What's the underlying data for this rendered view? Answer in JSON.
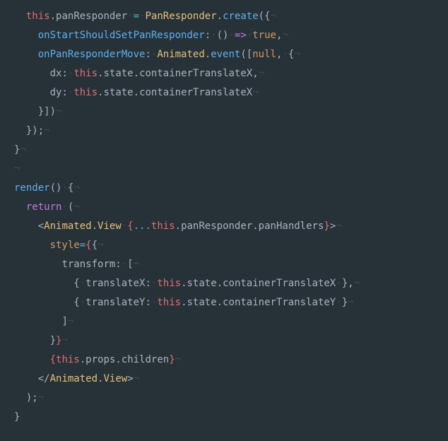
{
  "code": {
    "l1": {
      "this": "this",
      "dot": ".",
      "panResponder": "panResponder",
      "sp": " ",
      "eq": "=",
      "cls": "PanResponder",
      "create": "create",
      "lp": "(",
      "lb": "{"
    },
    "l2": {
      "key": "onStartShouldSetPanResponder",
      "colon": ":",
      "lp": "(",
      "rp": ")",
      "arrow": "=>",
      "val": "true",
      "comma": ","
    },
    "l3": {
      "key": "onPanResponderMove",
      "colon": ":",
      "cls": "Animated",
      "dot": ".",
      "event": "event",
      "lp": "(",
      "lsb": "[",
      "null": "null",
      "comma": ",",
      "lb": "{"
    },
    "l4": {
      "key": "dx",
      "colon": ":",
      "this": "this",
      "dot": ".",
      "state": "state",
      "ctr": "containerTranslateX",
      "comma": ","
    },
    "l5": {
      "key": "dy",
      "colon": ":",
      "this": "this",
      "dot": ".",
      "state": "state",
      "ctr": "containerTranslateX"
    },
    "l6": {
      "rb": "}",
      "rsb": "]",
      "rp": ")"
    },
    "l7": {
      "rb": "}",
      "rp": ")",
      "semi": ";"
    },
    "l8": {
      "rb": "}"
    },
    "l10": {
      "render": "render",
      "lp": "(",
      "rp": ")",
      "lb": "{"
    },
    "l11": {
      "return": "return",
      "lp": "("
    },
    "l12": {
      "lt": "<",
      "cls": "Animated",
      "dot": ".",
      "view": "View",
      "sp": " ",
      "lb": "{",
      "spread": "...",
      "this": "this",
      "pr": "panResponder",
      "ph": "panHandlers",
      "rb": "}",
      "gt": ">"
    },
    "l13": {
      "attr": "style",
      "eq": "=",
      "lb1": "{",
      "lb2": "{"
    },
    "l14": {
      "key": "transform",
      "colon": ":",
      "lsb": "["
    },
    "l15": {
      "lb": "{",
      "key": "translateX",
      "colon": ":",
      "this": "this",
      "dot": ".",
      "state": "state",
      "ctr": "containerTranslateX",
      "rb": "}",
      "comma": ","
    },
    "l16": {
      "lb": "{",
      "key": "translateY",
      "colon": ":",
      "this": "this",
      "dot": ".",
      "state": "state",
      "ctr": "containerTranslateY",
      "rb": "}"
    },
    "l17": {
      "rsb": "]"
    },
    "l18": {
      "rb1": "}",
      "rb2": "}"
    },
    "l19": {
      "lb": "{",
      "this": "this",
      "dot": ".",
      "props": "props",
      "children": "children",
      "rb": "}"
    },
    "l20": {
      "lt": "<",
      "slash": "/",
      "cls": "Animated",
      "dot": ".",
      "view": "View",
      "gt": ">"
    },
    "l21": {
      "rp": ")",
      "semi": ";"
    },
    "l22": {
      "rb": "}"
    }
  },
  "whitespace": {
    "mid": "·",
    "end": "¬"
  }
}
